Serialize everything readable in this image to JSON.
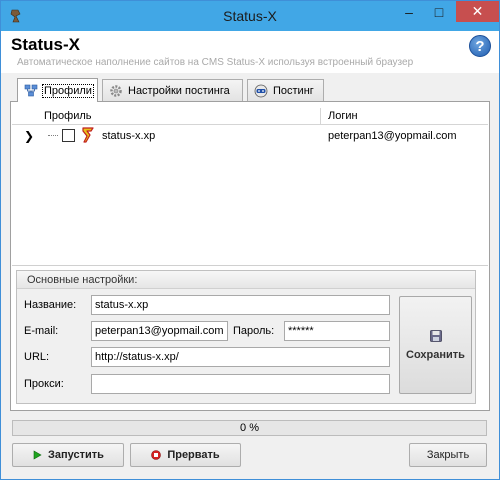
{
  "window": {
    "title": "Status-X",
    "minimize": "–",
    "maximize": "□",
    "close": "✕"
  },
  "header": {
    "title": "Status-X",
    "subtitle": "Автоматическое наполнение сайтов на CMS Status-X используя встроенный браузер",
    "help": "?"
  },
  "tabs": [
    {
      "label": "Профили",
      "icon": "profiles-icon",
      "active": true
    },
    {
      "label": "Настройки постинга",
      "icon": "gear-icon",
      "active": false
    },
    {
      "label": "Постинг",
      "icon": "robot-icon",
      "active": false
    }
  ],
  "grid": {
    "columns": [
      "Профиль",
      "Логин"
    ],
    "rows": [
      {
        "expander": "❯",
        "profile": "status-x.xp",
        "login": "peterpan13@yopmail.com",
        "checked": false
      }
    ]
  },
  "settings": {
    "title": "Основные настройки:",
    "name_label": "Название:",
    "name_value": "status-x.xp",
    "email_label": "E-mail:",
    "email_value": "peterpan13@yopmail.com",
    "password_label": "Пароль:",
    "password_value": "******",
    "url_label": "URL:",
    "url_value": "http://status-x.xp/",
    "proxy_label": "Прокси:",
    "proxy_value": "",
    "save_label": "Сохранить"
  },
  "progress": {
    "value": 0,
    "text": "0 %"
  },
  "buttons": {
    "start": "Запустить",
    "stop": "Прервать",
    "close": "Закрыть"
  },
  "colors": {
    "titlebar": "#41a7e6",
    "close_button": "#c74f4f",
    "start_icon": "#1fa31f",
    "stop_icon": "#d42020"
  }
}
